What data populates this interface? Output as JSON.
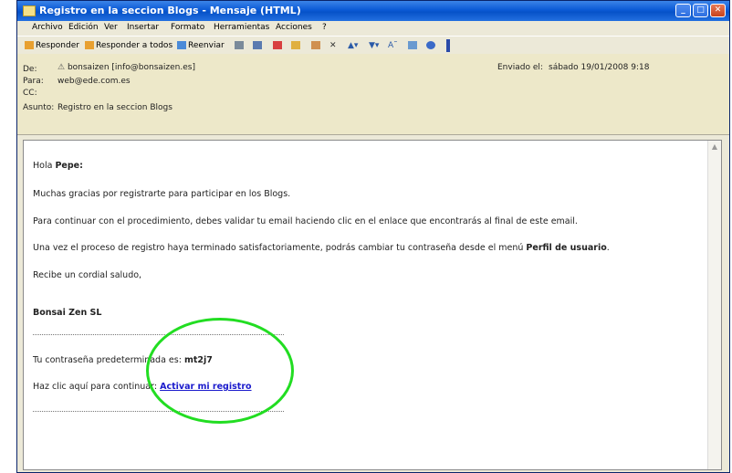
{
  "window": {
    "title": "Registro en la seccion Blogs - Mensaje (HTML)"
  },
  "menu": [
    "Archivo",
    "Edición",
    "Ver",
    "Insertar",
    "Formato",
    "Herramientas",
    "Acciones",
    "?"
  ],
  "toolbar": {
    "reply": "Responder",
    "reply_all": "Responder a todos",
    "forward": "Reenviar"
  },
  "header": {
    "from_label": "De:",
    "from_value": "bonsaizen [info@bonsaizen.es]",
    "to_label": "Para:",
    "to_value": "web@ede.com.es",
    "cc_label": "CC:",
    "cc_value": "",
    "subject_label": "Asunto:",
    "subject_value": "Registro en la seccion Blogs",
    "sent_label": "Enviado el:",
    "sent_value": "sábado 19/01/2008 9:18"
  },
  "body": {
    "greeting_prefix": "Hola ",
    "greeting_name": "Pepe:",
    "line1": "Muchas gracias por registrarte para participar en los Blogs.",
    "line2": "Para continuar con el procedimiento, debes validar tu email haciendo clic en el enlace que encontrarás al final de este email.",
    "line3_prefix": "Una vez el proceso de registro haya terminado satisfactoriamente, podrás cambiar tu contraseña desde el menú ",
    "line3_bold": "Perfil de usuario",
    "line3_suffix": ".",
    "line4": "Recibe un cordial saludo,",
    "signature": "Bonsai Zen SL",
    "password_prefix": "Tu contraseña predeterminada es: ",
    "password_value": "mt2j7",
    "activate_prefix": "Haz clic aquí para continuar: ",
    "activate_link": "Activar mi registro"
  },
  "colors": {
    "annotation": "#22dd22",
    "link": "#1a1acc"
  }
}
